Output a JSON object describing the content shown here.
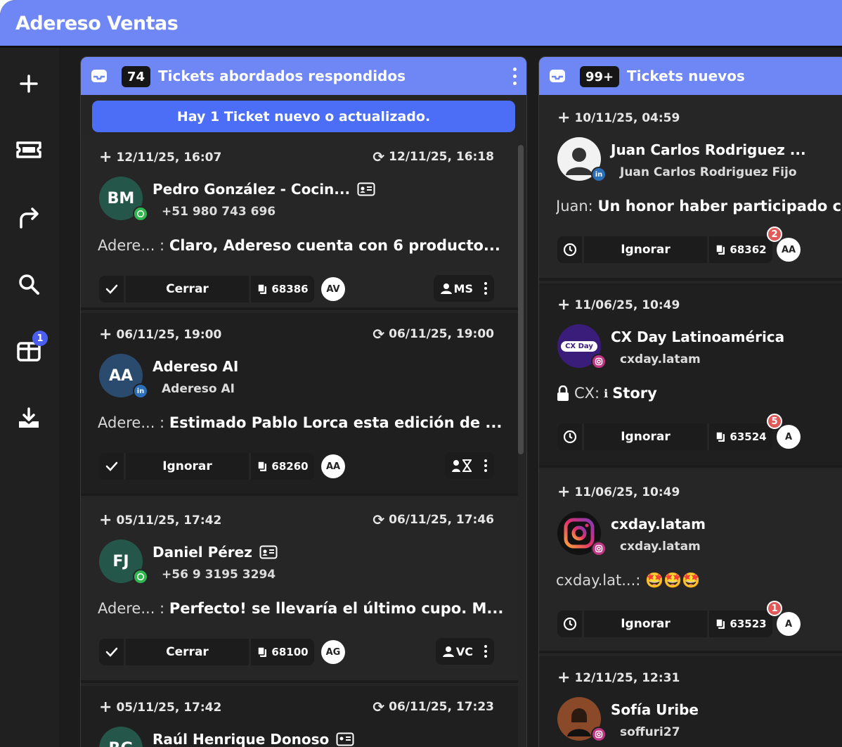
{
  "app": {
    "title": "Adereso Ventas"
  },
  "sidebar": {
    "items": [
      {
        "name": "plus-icon"
      },
      {
        "name": "ticket-icon"
      },
      {
        "name": "forward-icon"
      },
      {
        "name": "search-icon"
      },
      {
        "name": "board-icon",
        "badge": "1"
      },
      {
        "name": "download-icon"
      }
    ]
  },
  "columns": [
    {
      "count": "74",
      "title": "Tickets abordados respondidos",
      "banner": "Hay 1 Ticket nuevo o actualizado.",
      "tickets": [
        {
          "created": "12/11/25, 16:07",
          "updated": "12/11/25, 16:18",
          "initials": "BM",
          "name": "Pedro González - Cocin...",
          "sub": "+51 980 743 696",
          "who": "Adere... :",
          "text": "Claro, Adereso cuenta con 6 producto...",
          "action": "Cerrar",
          "ref": "68386",
          "owner": "AV",
          "assignee": "MS"
        },
        {
          "created": "06/11/25, 19:00",
          "updated": "06/11/25, 19:00",
          "initials": "AA",
          "name": "Adereso AI",
          "sub": "Adereso AI",
          "who": "Adere... :",
          "text": "Estimado Pablo Lorca esta edición de ...",
          "action": "Ignorar",
          "ref": "68260",
          "owner": "AA",
          "assignee": ""
        },
        {
          "created": "05/11/25, 17:42",
          "updated": "06/11/25, 17:46",
          "initials": "FJ",
          "name": "Daniel Pérez",
          "sub": "+56 9 3195 3294",
          "who": "Adere... :",
          "text": "Perfecto! se llevaría el último cupo. M...",
          "action": "Cerrar",
          "ref": "68100",
          "owner": "AG",
          "assignee": "VC"
        },
        {
          "created": "05/11/25, 17:42",
          "updated": "06/11/25, 17:23",
          "initials": "RG",
          "name": "Raúl Henrique Donoso",
          "sub": "",
          "who": "",
          "text": "",
          "action": "",
          "ref": "",
          "owner": "",
          "assignee": ""
        }
      ]
    },
    {
      "count": "99+",
      "title": "Tickets nuevos",
      "tickets": [
        {
          "created": "10/11/25, 04:59",
          "name": "Juan Carlos Rodriguez ...",
          "sub": "Juan Carlos Rodriguez Fijo",
          "who": "Juan:",
          "text": "Un honor haber participado c",
          "action": "Ignorar",
          "ref": "68362",
          "owner": "AA",
          "notif": "2"
        },
        {
          "created": "11/06/25, 10:49",
          "name": "CX Day Latinoamérica",
          "sub": "cxday.latam",
          "who": "CX:",
          "text": "Story",
          "action": "Ignorar",
          "ref": "63524",
          "owner": "A",
          "notif": "5",
          "avatar_text": "CX Day"
        },
        {
          "created": "11/06/25, 10:49",
          "name": "cxday.latam",
          "sub": "cxday.latam",
          "who": "cxday.lat...:",
          "text": "🤩🤩🤩",
          "action": "Ignorar",
          "ref": "63523",
          "owner": "A",
          "notif": "1"
        },
        {
          "created": "12/11/25, 12:31",
          "name": "Sofía Uribe",
          "sub": "soffuri27",
          "who": "",
          "text": "",
          "action": "",
          "ref": "",
          "owner": "",
          "notif": ""
        }
      ]
    }
  ]
}
